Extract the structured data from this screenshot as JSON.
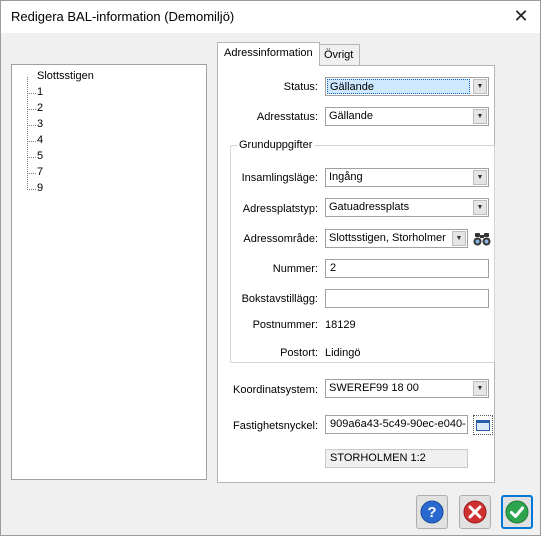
{
  "window": {
    "title": "Redigera BAL-information (Demomiljö)",
    "close_glyph": "✕"
  },
  "tree": {
    "root": "Slottsstigen",
    "items": [
      "1",
      "2",
      "3",
      "4",
      "5",
      "7",
      "9"
    ]
  },
  "tabs": [
    {
      "label": "Adressinformation",
      "active": true
    },
    {
      "label": "Övrigt",
      "active": false
    }
  ],
  "form": {
    "status": {
      "label": "Status:",
      "value": "Gällande"
    },
    "adresstatus": {
      "label": "Adresstatus:",
      "value": "Gällande"
    },
    "group_title": "Grunduppgifter",
    "insamlingslage": {
      "label": "Insamlingsläge:",
      "value": "Ingång"
    },
    "adressplatstyp": {
      "label": "Adressplatstyp:",
      "value": "Gatuadressplats"
    },
    "adressomrade": {
      "label": "Adressområde:",
      "value": "Slottsstigen, Storholmer"
    },
    "nummer": {
      "label": "Nummer:",
      "value": "2"
    },
    "bokstavstillagg": {
      "label": "Bokstavstillägg:",
      "value": ""
    },
    "postnummer": {
      "label": "Postnummer:",
      "value": "18129"
    },
    "postort": {
      "label": "Postort:",
      "value": "Lidingö"
    },
    "koordinatsystem": {
      "label": "Koordinatsystem:",
      "value": "SWEREF99 18 00"
    },
    "fastighetsnyckel": {
      "label": "Fastighetsnyckel:",
      "value": "909a6a43-5c49-90ec-e040-"
    },
    "fastighet": "STORHOLMEN 1:2"
  },
  "icons": {
    "dropdown": "chevron-down-icon",
    "search": "binoculars-icon",
    "map": "map-window-icon",
    "help": "help-icon",
    "cancel": "cancel-icon",
    "ok": "ok-check-icon"
  },
  "colors": {
    "help_blue": "#2a6ad0",
    "cancel_red": "#d03030",
    "ok_green": "#2ea44f",
    "selection": "#cde8ff"
  }
}
